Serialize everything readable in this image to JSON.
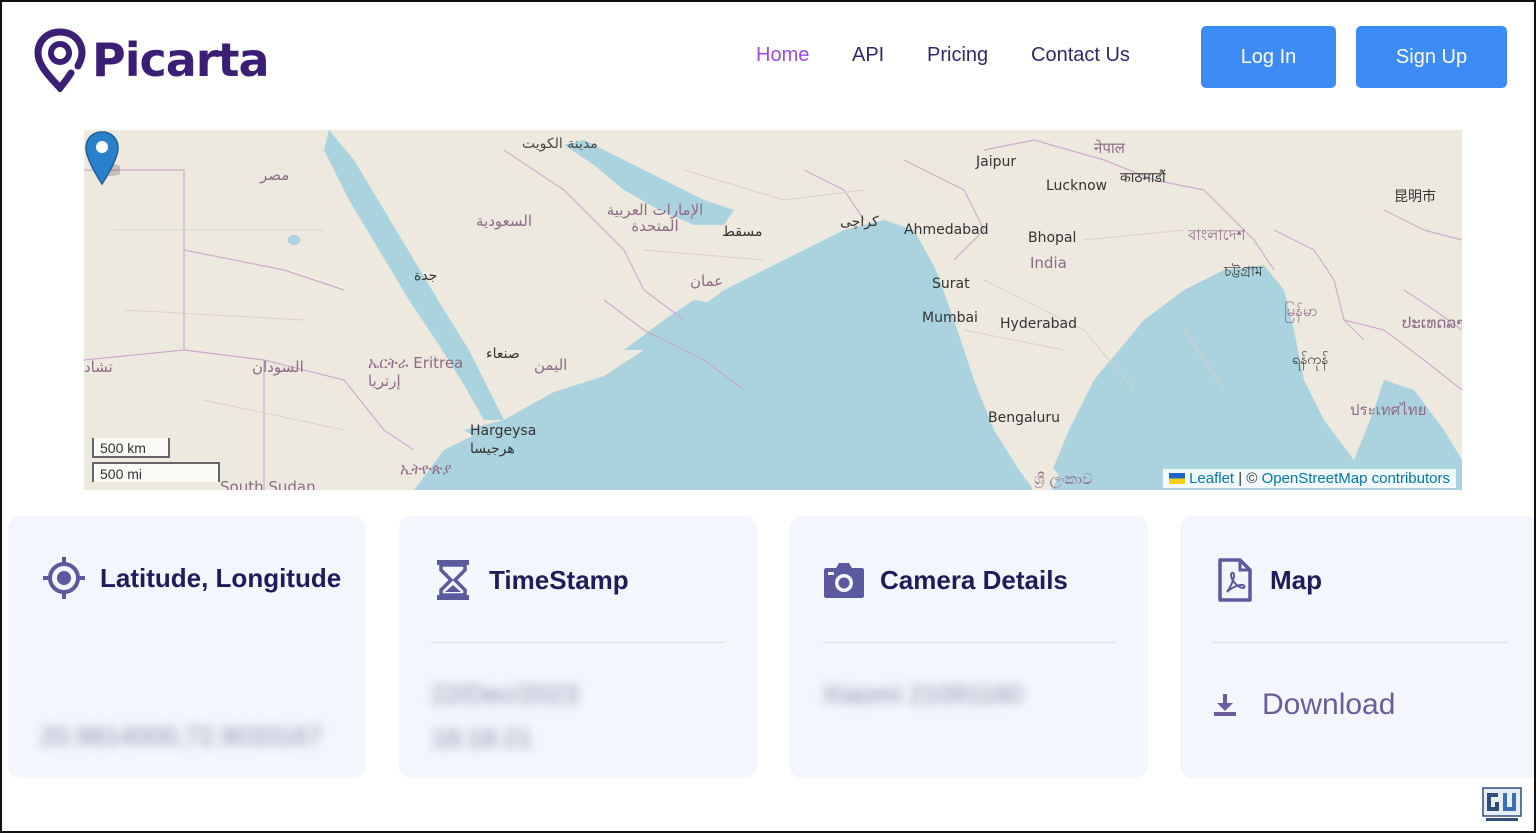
{
  "brand": {
    "name": "Picarta",
    "color": "#3b1f75"
  },
  "nav": {
    "items": [
      {
        "label": "Home",
        "active": true
      },
      {
        "label": "API",
        "active": false
      },
      {
        "label": "Pricing",
        "active": false
      },
      {
        "label": "Contact Us",
        "active": false
      }
    ],
    "login_label": "Log In",
    "signup_label": "Sign Up",
    "accent": "#3d8bf5",
    "active_color": "#9a4ce0"
  },
  "map": {
    "labels": {
      "kuwait": "مدينة الكويت",
      "egypt": "مصر",
      "saudi": "السعودية",
      "uae": "الإمارات العربية المتحدة",
      "muscat": "مسقط",
      "karachi": "كراچی",
      "jeddah": "جدة",
      "oman": "عمان",
      "sanaa": "صنعاء",
      "yemen": "اليمن",
      "eritrea": "ኤርትራ Eritrea إرتريا",
      "sudan": "السودان",
      "chad": "تشاد",
      "hargeysa": "Hargeysa هرجيسا",
      "ethiopia": "ኢትዮጵያ",
      "south_sudan": "South Sudan",
      "jaipur": "Jaipur",
      "lucknow": "Lucknow",
      "nepal": "नेपाल",
      "kathmandu": "काठमाडौं",
      "ahmedabad": "Ahmedabad",
      "bhopal": "Bhopal",
      "india": "India",
      "surat": "Surat",
      "mumbai": "Mumbai",
      "hyderabad": "Hyderabad",
      "bengaluru": "Bengaluru",
      "bangladesh": "বাংলাদেশ",
      "chattogram": "চট্টগ্রাম",
      "myanmar": "မြန်မာ",
      "yangon": "ရန်ကုန်",
      "kunming": "昆明市",
      "sri_lanka": "ශ්‍රී ලංකාව",
      "thailand": "ประเทศไทย",
      "laos": "ປະເທດລາວ"
    },
    "scale_km": "500 km",
    "scale_mi": "500 mi",
    "attribution_leaflet": "Leaflet",
    "attribution_sep": " | © ",
    "attribution_osm": "OpenStreetMap contributors"
  },
  "cards": [
    {
      "title": "Latitude, Longitude",
      "icon": "crosshair-icon",
      "value": "20.9814000,72.9033167"
    },
    {
      "title": "TimeStamp",
      "icon": "hourglass-icon",
      "value_line1": "22/Dec/2023",
      "value_line2": "18:18:21"
    },
    {
      "title": "Camera Details",
      "icon": "camera-icon",
      "value": "Xiaomi 21091160"
    },
    {
      "title": "Map",
      "icon": "pdf-file-icon",
      "download_label": "Download"
    }
  ],
  "colors": {
    "card_bg": "#f3f6fc",
    "card_title": "#1f1c5c",
    "icon": "#5b5a9e"
  }
}
